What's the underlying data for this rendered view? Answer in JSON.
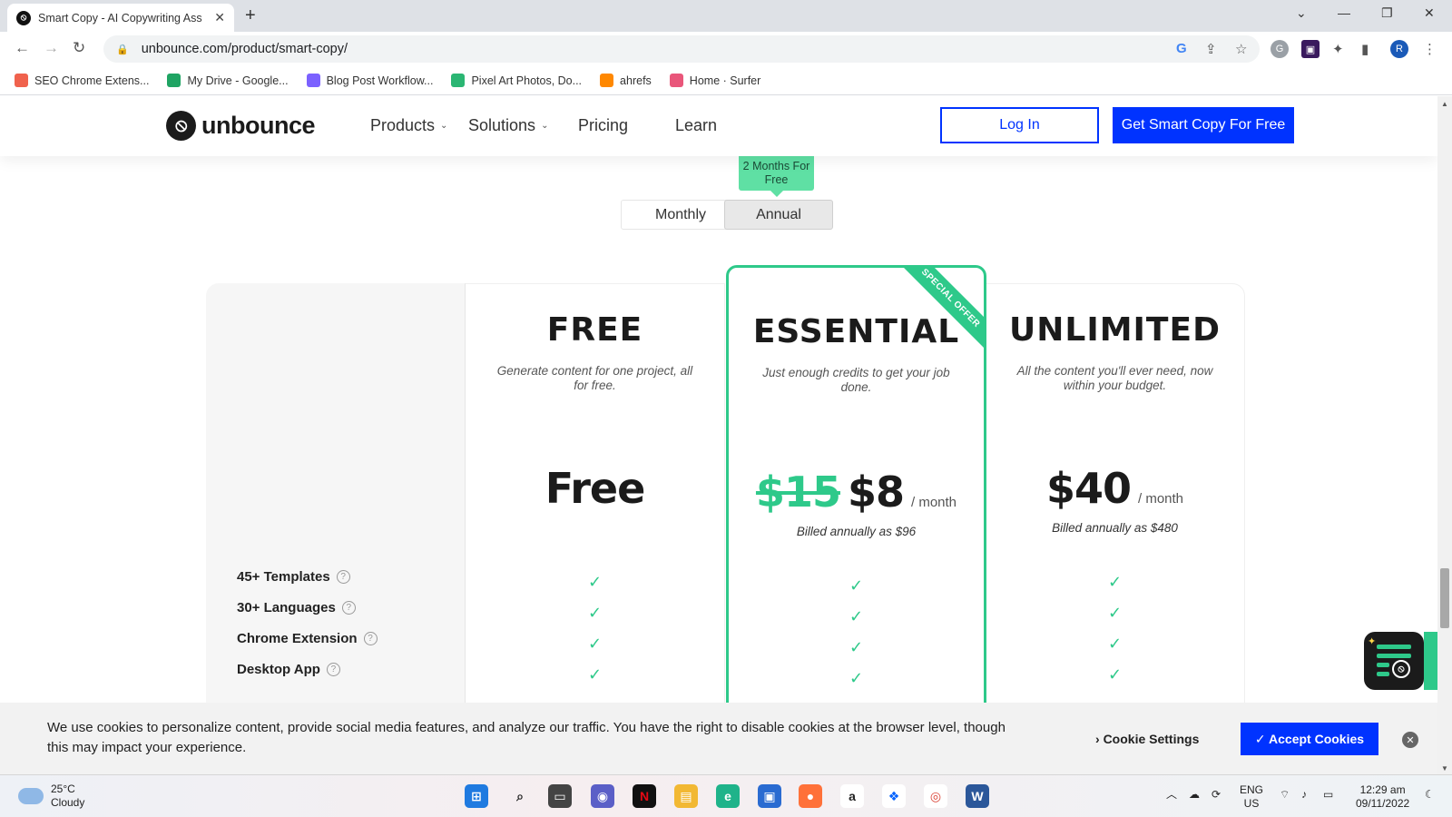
{
  "browser": {
    "tab_title": "Smart Copy - AI Copywriting Ass",
    "url": "unbounce.com/product/smart-copy/",
    "profile_initial": "R",
    "bookmarks": [
      {
        "label": "SEO Chrome Extens...",
        "color": "#f0624d"
      },
      {
        "label": "My Drive - Google...",
        "color": "#1fa463"
      },
      {
        "label": "Blog Post Workflow...",
        "color": "#7b61ff"
      },
      {
        "label": "Pixel Art Photos, Do...",
        "color": "#2bb673"
      },
      {
        "label": "ahrefs",
        "color": "#ff8800"
      },
      {
        "label": "Home · Surfer",
        "color": "#e9567a"
      }
    ]
  },
  "site": {
    "logo": "unbounce",
    "nav": {
      "products": "Products",
      "solutions": "Solutions",
      "pricing": "Pricing",
      "learn": "Learn"
    },
    "login": "Log In",
    "cta": "Get Smart Copy For Free"
  },
  "billing": {
    "promo": "2 Months For Free",
    "monthly": "Monthly",
    "annual": "Annual",
    "selected": "Annual"
  },
  "plans": {
    "free": {
      "name": "FREE",
      "desc": "Generate content for one project, all for free.",
      "price": "Free"
    },
    "essential": {
      "ribbon": "SPECIAL OFFER",
      "name": "ESSENTIAL",
      "desc": "Just enough credits to get your job done.",
      "old_price": "$15",
      "price": "$8",
      "per": "/   month",
      "billed": "Billed annually as $96"
    },
    "unlimited": {
      "name": "UNLIMITED",
      "desc": "All the content you'll ever need, now within your budget.",
      "price": "$40",
      "per": "/   month",
      "billed": "Billed annually as $480"
    }
  },
  "features": [
    "45+ Templates",
    "30+ Languages",
    "Chrome Extension",
    "Desktop App"
  ],
  "cookie": {
    "text": "We use cookies to personalize content, provide social media features, and analyze our traffic. You have the right to disable cookies at the browser level, though this may impact your experience.",
    "settings": "Cookie Settings",
    "accept": "✓ Accept Cookies"
  },
  "taskbar": {
    "temp": "25°C",
    "weather": "Cloudy",
    "lang": "ENG",
    "region": "US",
    "time": "12:29 am",
    "date": "09/11/2022"
  }
}
